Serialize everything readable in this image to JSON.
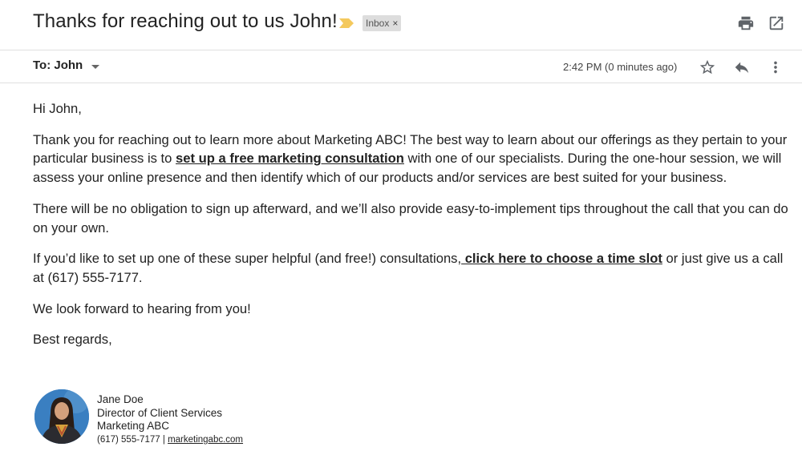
{
  "email": {
    "subject": "Thanks for reaching out to us John!",
    "label": "Inbox",
    "label_remove": "×",
    "to": "To: John",
    "timestamp": "2:42 PM (0 minutes ago)"
  },
  "icons": {
    "importance": "importance-marker-icon",
    "print": "print-icon",
    "new_window": "open-in-new-window-icon",
    "caret": "chevron-down-icon",
    "star": "star-icon",
    "reply": "reply-icon",
    "more": "more-vert-icon"
  },
  "colors": {
    "importance": "#f4c95d",
    "label_bg": "#dddddd",
    "icon": "#5f6368",
    "divider": "#e0e0e0"
  },
  "message": {
    "greeting": "Hi John,",
    "p1_before": "Thank you for reaching out to learn more about Marketing ABC! The best way to learn about our offerings as they pertain to your particular business is to ",
    "p1_link": "set up a free marketing consultation",
    "p1_after": " with one of our specialists. During the one-hour session, we will assess your online presence and then identify which of our products and/or services are best suited for your business.",
    "p2": "There will be no obligation to sign up afterward, and we’ll also provide easy-to-implement tips throughout the call that you can do on your own.",
    "p3_before": "If you’d like to set up one of these super helpful (and free!) consultations,",
    "p3_link": " click here to choose a time slot",
    "p3_after": " or just give us a call at (617) 555-7177.",
    "p4": "We look forward to hearing from you!",
    "closing": "Best regards,"
  },
  "signature": {
    "name": "Jane Doe",
    "title": "Director of Client Services",
    "company": "Marketing ABC",
    "phone": "(617) 555-7177",
    "separator": "|",
    "website": "marketingabc.com"
  }
}
